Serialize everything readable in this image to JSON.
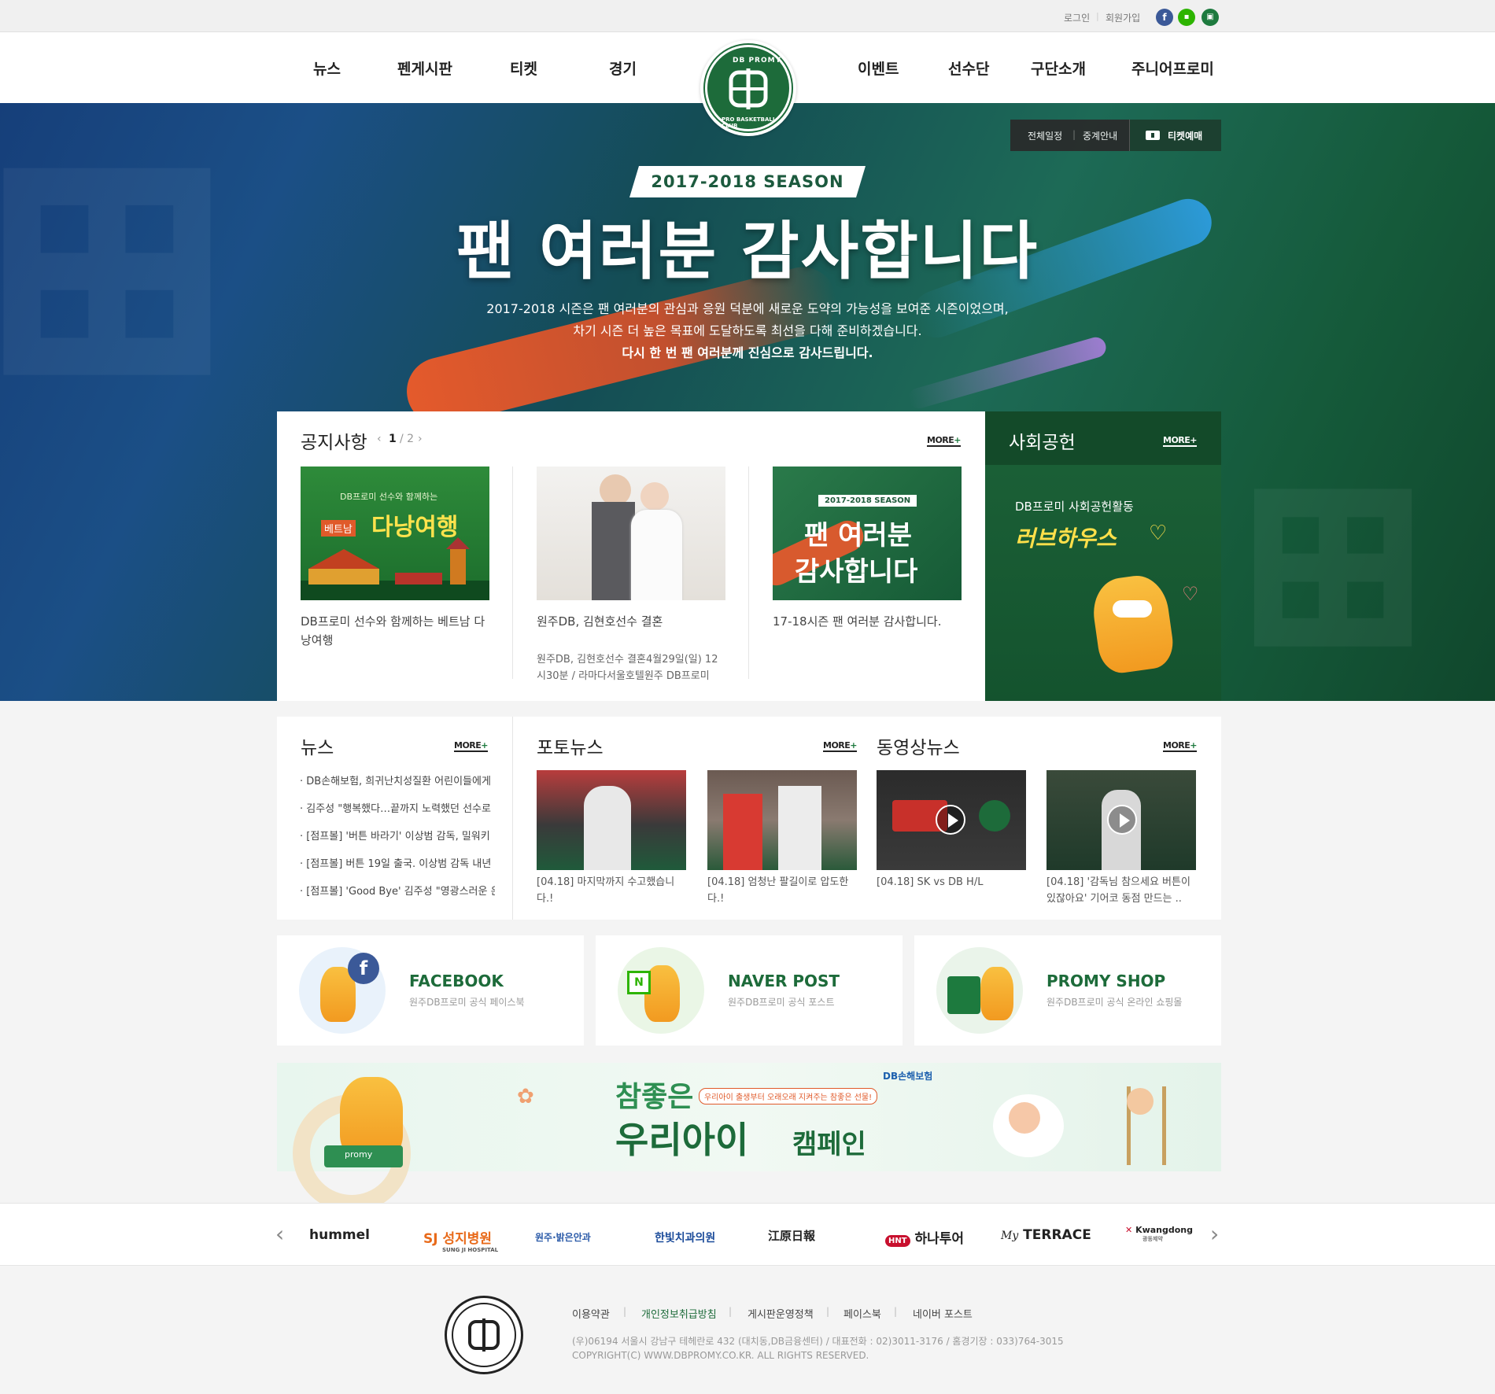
{
  "util": {
    "login": "로그인",
    "join": "회원가입",
    "icons": [
      "facebook-icon",
      "naver-post-icon",
      "shop-icon"
    ]
  },
  "nav": {
    "left": [
      "뉴스",
      "펜게시판",
      "티켓",
      "경기"
    ],
    "right": [
      "이벤트",
      "선수단",
      "구단소개",
      "주니어프로미"
    ]
  },
  "logo": {
    "top": "DB PROMY",
    "bottom": "PRO BASKETBALL CLUB"
  },
  "hero": {
    "season": "2017-2018 SEASON",
    "title": "팬 여러분 감사합니다",
    "line1": "2017-2018 시즌은 팬 여러분의 관심과 응원 덕분에 새로운 도약의 가능성을 보여준 시즌이었으며,",
    "line2": "차기 시즌 더 높은 목표에 도달하도록 최선을 다해 준비하겠습니다.",
    "line3": "다시 한 번 팬 여러분께 진심으로 감사드립니다.",
    "schedule": "전체일정",
    "broadcast": "중계안내",
    "ticket": "티켓예매"
  },
  "notice": {
    "title": "공지사항",
    "page_current": "1",
    "page_total": "/ 2",
    "more": "MORE",
    "items": [
      {
        "caption": "DB프로미 선수와 함께하는 베트남 다낭여행",
        "img_top": "DB프로미 선수와 함께하는",
        "img_main": "다낭여행",
        "img_tag": "베트남"
      },
      {
        "caption": "원주DB, 김현호선수 결혼",
        "desc": "원주DB, 김현호선수 결혼4월29일(일) 12시30분 / 라마다서울호텔원주 DB프로미"
      },
      {
        "caption": "17-18시즌 팬 여러분 감사합니다.",
        "img_season": "2017-2018 SEASON",
        "img_l1": "팬 여러분",
        "img_l2": "감사합니다"
      }
    ]
  },
  "social": {
    "title": "사회공헌",
    "more": "MORE",
    "sub": "DB프로미 사회공헌활동",
    "script": "러브하우스"
  },
  "news": {
    "title": "뉴스",
    "more": "MORE",
    "items": [
      "DB손해보험, 희귀난치성질환 어린이들에게",
      "김주성 \"행복했다…끝까지 노력했던 선수로",
      "[점프볼] '버튼 바라기' 이상범 감독, 밀워키",
      "[점프볼] 버튼 19일 출국. 이상범 감독 내년",
      "[점프볼] 'Good Bye' 김주성 \"영광스러운 은퇴"
    ]
  },
  "photo": {
    "title": "포토뉴스",
    "more": "MORE",
    "items": [
      "[04.18] 마지막까지 수고했습니다.!",
      "[04.18] 엄청난 팔길이로 압도한다.!"
    ]
  },
  "video": {
    "title": "동영상뉴스",
    "more": "MORE",
    "items": [
      "[04.18] SK vs DB H/L",
      "[04.18] '감독님 참으세요 버튼이 있잖아요' 기어코 동점 만드는 .."
    ]
  },
  "sns": [
    {
      "title": "FACEBOOK",
      "desc": "원주DB프로미 공식 페이스북"
    },
    {
      "title": "NAVER POST",
      "desc": "원주DB프로미 공식 포스트"
    },
    {
      "title": "PROMY SHOP",
      "desc": "원주DB프로미 공식 온라인 쇼핑몰"
    }
  ],
  "banner": {
    "l1": "참좋은",
    "tag": "우리아이 출생부터 오래오래 지켜주는 참좋은 선물!",
    "l2": "우리아이",
    "l3": "캠페인",
    "brand": "DB손해보험",
    "mascot_label": "promy"
  },
  "partners": [
    "hummel",
    "성지병원",
    "원주·밝은안과",
    "한빛치과의원",
    "江原日報",
    "하나투어",
    "TERRACE",
    "Kwangdong"
  ],
  "partner_aux": {
    "sungji_en": "SUNG JI HOSPITAL",
    "hana_badge": "HNT",
    "terrace_pre": "My",
    "kwangdong_sub": "광동제약"
  },
  "footer": {
    "links": [
      "이용약관",
      "개인정보취급방침",
      "게시판운영정책",
      "페이스북",
      "네이버 포스트"
    ],
    "address": "(우)06194 서울시 강남구 테헤란로 432 (대치동,DB금융센터)  /  대표전화 : 02)3011-3176  /  홈경기장 : 033)764-3015",
    "copyright": "COPYRIGHT(C) WWW.DBPROMY.CO.KR. ALL RIGHTS RESERVED."
  },
  "colors": {
    "brand_green": "#1d6b3a",
    "accent_orange": "#e45a2c",
    "facebook": "#3b5998",
    "naver": "#2db400"
  }
}
